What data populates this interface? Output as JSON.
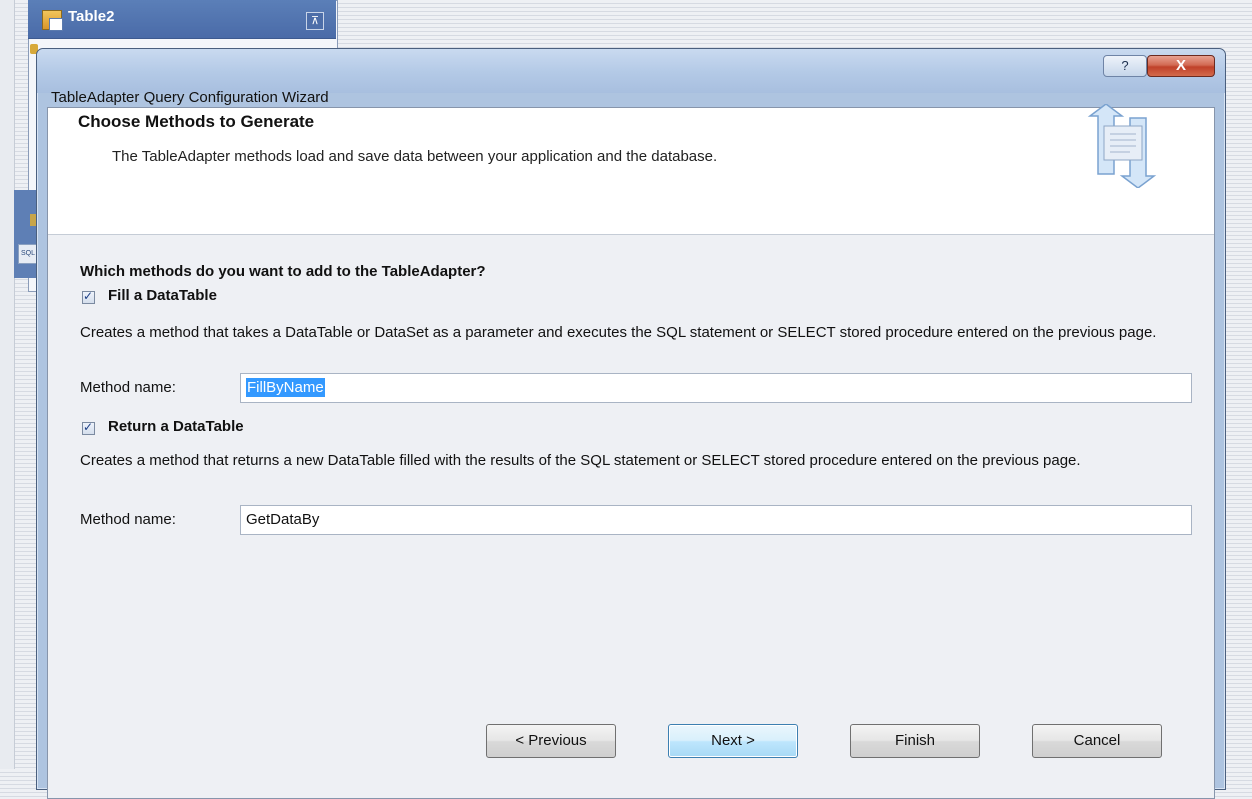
{
  "background": {
    "table_title": "Table2",
    "sql_icon_text": "SQL",
    "collapse_glyph": "⊼"
  },
  "dialog": {
    "title": "TableAdapter Query Configuration Wizard",
    "help_glyph": "?",
    "close_glyph": "X"
  },
  "header": {
    "title": "Choose Methods to Generate",
    "subtitle": "The TableAdapter methods load and save data between your application and the database."
  },
  "body": {
    "question": "Which methods do you want to add to the TableAdapter?",
    "fill": {
      "label": "Fill a DataTable",
      "checked": true,
      "description": "Creates a method that takes a DataTable or DataSet as a parameter and executes the SQL statement or SELECT stored procedure entered on the previous page.",
      "method_label": "Method name:",
      "method_value": "FillByName"
    },
    "return": {
      "label": "Return a DataTable",
      "checked": true,
      "description": "Creates a method that returns a new DataTable filled with the results of the SQL statement or SELECT stored procedure entered on the previous page.",
      "method_label": "Method name:",
      "method_value": "GetDataBy"
    }
  },
  "buttons": {
    "previous": "< Previous",
    "next": "Next >",
    "finish": "Finish",
    "cancel": "Cancel"
  },
  "colors": {
    "selection": "#3399ff",
    "titlebar": "#b3c9e6",
    "close": "#c0412a"
  },
  "icons": [
    "table-icon",
    "collapse-icon",
    "key-icon",
    "sql-icon",
    "help-icon",
    "close-icon",
    "wizard-arrows-icon",
    "checkbox-check-icon"
  ]
}
